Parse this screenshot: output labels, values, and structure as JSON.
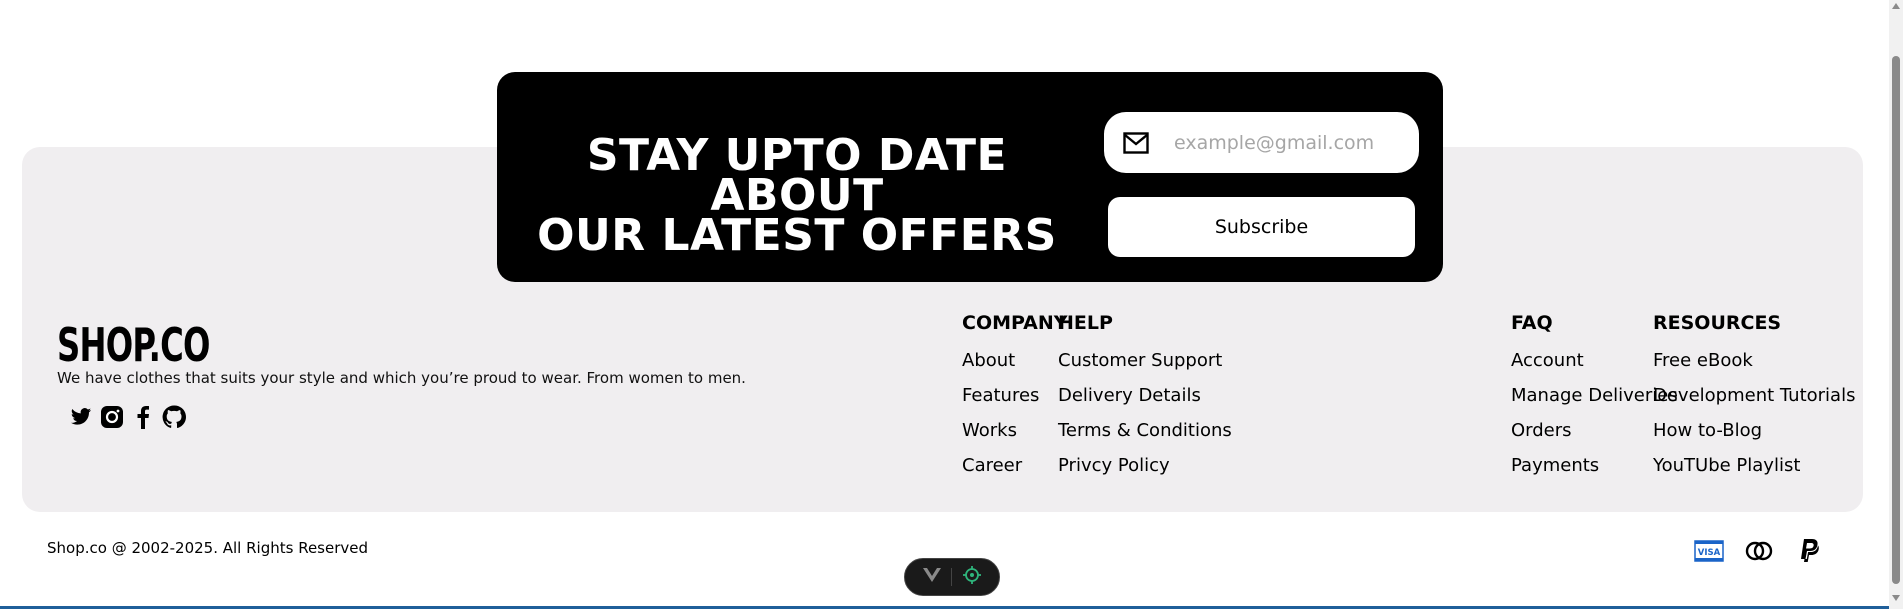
{
  "newsletter": {
    "title_line1": "STAY UPTO DATE ABOUT",
    "title_line2": "OUR LATEST OFFERS",
    "email_placeholder": "example@gmail.com",
    "email_icon": "mail-icon",
    "subscribe_label": "Subscribe"
  },
  "brand": {
    "name": "SHOP.CO",
    "tagline": "We have clothes that suits your style and which you’re proud to wear. From women to men.",
    "socials": [
      "twitter-icon",
      "instagram-icon",
      "facebook-icon",
      "github-icon"
    ]
  },
  "columns": {
    "company": {
      "title": "COMPANY",
      "links": [
        "About",
        "Features",
        "Works",
        "Career"
      ]
    },
    "help": {
      "title": "HELP",
      "links": [
        "Customer Support",
        "Delivery Details",
        "Terms & Conditions",
        "Privcy Policy"
      ]
    },
    "faq": {
      "title": "FAQ",
      "links": [
        "Account",
        "Manage Deliveries",
        "Orders",
        "Payments"
      ]
    },
    "resources": {
      "title": "RESOURCES",
      "links": [
        "Free eBook",
        "Development Tutorials",
        "How to-Blog",
        "YouTUbe Playlist"
      ]
    }
  },
  "bottom": {
    "copyright": "Shop.co @ 2002-2025. All Rights Reserved",
    "payments": [
      "visa-icon",
      "mastercard-icon",
      "paypal-icon"
    ],
    "visa_text": "VISA"
  },
  "colors": {
    "panel_bg": "#f0eef0",
    "newsletter_bg": "#000000",
    "visa_blue": "#1a64c8",
    "devtools_green": "#2fb57c"
  }
}
